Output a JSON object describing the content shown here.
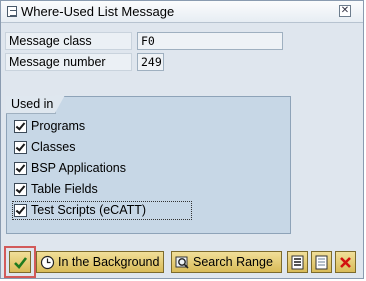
{
  "window": {
    "title": "Where-Used List Message"
  },
  "fields": {
    "message_class_label": "Message class",
    "message_class_value": "F0",
    "message_number_label": "Message number",
    "message_number_value": "249"
  },
  "used_in": {
    "title": "Used in",
    "items": [
      {
        "label": "Programs",
        "checked": true
      },
      {
        "label": "Classes",
        "checked": true
      },
      {
        "label": "BSP Applications",
        "checked": true
      },
      {
        "label": "Table Fields",
        "checked": true
      },
      {
        "label": "Test Scripts (eCATT)",
        "checked": true
      }
    ]
  },
  "toolbar": {
    "background_label": "In the Background",
    "search_range_label": "Search Range"
  },
  "colors": {
    "accent_button": "#e3c86d",
    "cancel": "#d21010",
    "ok_highlight": "#d25a5a"
  }
}
